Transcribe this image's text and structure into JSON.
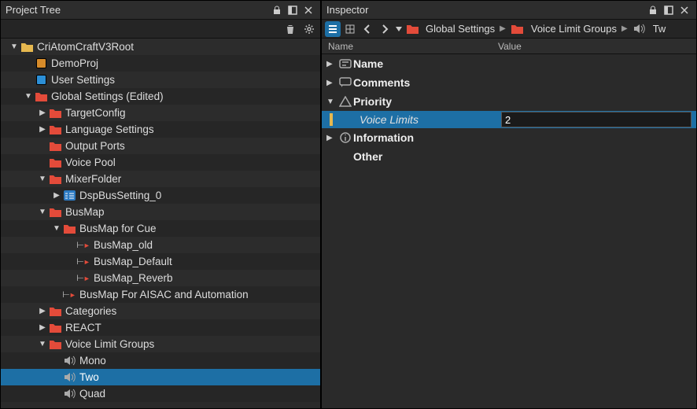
{
  "panels": {
    "project_tree": {
      "title": "Project Tree"
    },
    "inspector": {
      "title": "Inspector"
    }
  },
  "tree": [
    {
      "indent": 0,
      "arrow": "down",
      "icon": "folder-y",
      "label": "CriAtomCraftV3Root",
      "sel": false
    },
    {
      "indent": 1,
      "arrow": "none",
      "icon": "box-o",
      "label": "DemoProj",
      "sel": false
    },
    {
      "indent": 1,
      "arrow": "none",
      "icon": "box-b",
      "label": "User Settings",
      "sel": false
    },
    {
      "indent": 1,
      "arrow": "down",
      "icon": "folder-r",
      "label": "Global Settings (Edited)",
      "sel": false
    },
    {
      "indent": 2,
      "arrow": "right",
      "icon": "folder-r",
      "label": "TargetConfig",
      "sel": false
    },
    {
      "indent": 2,
      "arrow": "right",
      "icon": "folder-r",
      "label": "Language Settings",
      "sel": false
    },
    {
      "indent": 2,
      "arrow": "none",
      "icon": "folder-r",
      "label": "Output Ports",
      "sel": false
    },
    {
      "indent": 2,
      "arrow": "none",
      "icon": "folder-r",
      "label": "Voice Pool",
      "sel": false
    },
    {
      "indent": 2,
      "arrow": "down",
      "icon": "folder-r",
      "label": "MixerFolder",
      "sel": false
    },
    {
      "indent": 3,
      "arrow": "right",
      "icon": "box-blu",
      "label": "DspBusSetting_0",
      "sel": false
    },
    {
      "indent": 2,
      "arrow": "down",
      "icon": "folder-r",
      "label": "BusMap",
      "sel": false
    },
    {
      "indent": 3,
      "arrow": "down",
      "icon": "folder-r",
      "label": "BusMap for Cue",
      "sel": false
    },
    {
      "indent": 4,
      "arrow": "none",
      "icon": "bus",
      "label": "BusMap_old",
      "sel": false
    },
    {
      "indent": 4,
      "arrow": "none",
      "icon": "bus",
      "label": "BusMap_Default",
      "sel": false
    },
    {
      "indent": 4,
      "arrow": "none",
      "icon": "bus",
      "label": "BusMap_Reverb",
      "sel": false
    },
    {
      "indent": 3,
      "arrow": "none",
      "icon": "bus",
      "label": "BusMap For AISAC and Automation",
      "sel": false
    },
    {
      "indent": 2,
      "arrow": "right",
      "icon": "folder-r",
      "label": "Categories",
      "sel": false
    },
    {
      "indent": 2,
      "arrow": "right",
      "icon": "folder-r",
      "label": "REACT",
      "sel": false
    },
    {
      "indent": 2,
      "arrow": "down",
      "icon": "folder-r",
      "label": "Voice Limit Groups",
      "sel": false
    },
    {
      "indent": 3,
      "arrow": "none",
      "icon": "spk",
      "label": "Mono",
      "sel": false
    },
    {
      "indent": 3,
      "arrow": "none",
      "icon": "spk",
      "label": "Two",
      "sel": true
    },
    {
      "indent": 3,
      "arrow": "none",
      "icon": "spk",
      "label": "Quad",
      "sel": false
    }
  ],
  "breadcrumb": [
    {
      "icon": "folder-r",
      "label": "Global Settings"
    },
    {
      "icon": "folder-r",
      "label": "Voice Limit Groups"
    },
    {
      "icon": "spk",
      "label": "Tw"
    }
  ],
  "inspector_columns": {
    "name": "Name",
    "value": "Value"
  },
  "inspector_groups": [
    {
      "arrow": "right",
      "icon": "name",
      "label": "Name"
    },
    {
      "arrow": "right",
      "icon": "comment",
      "label": "Comments"
    },
    {
      "arrow": "down",
      "icon": "priority",
      "label": "Priority",
      "props": [
        {
          "label": "Voice Limits",
          "value": "2",
          "selected": true
        }
      ]
    },
    {
      "arrow": "right",
      "icon": "info",
      "label": "Information"
    },
    {
      "arrow": "none",
      "icon": "none",
      "label": "Other"
    }
  ]
}
